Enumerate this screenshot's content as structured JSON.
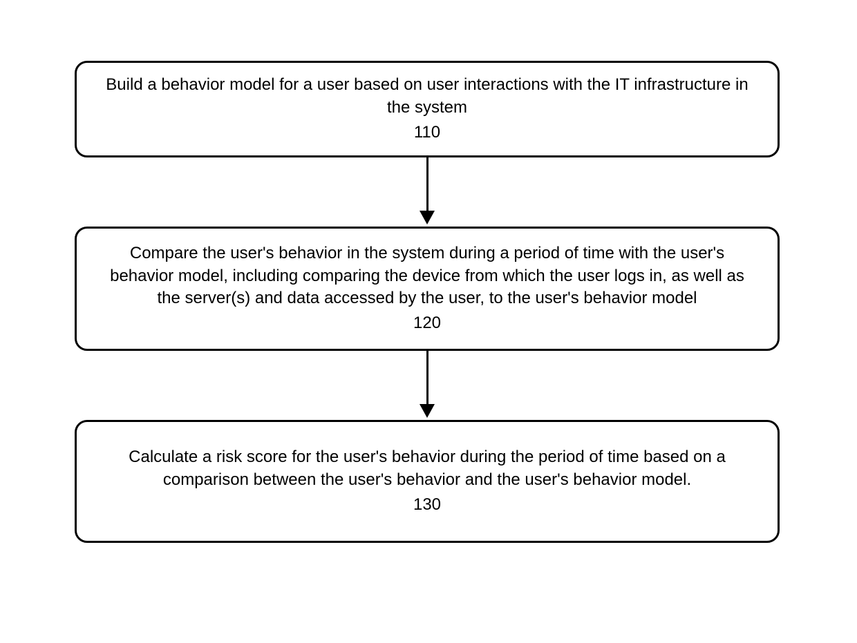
{
  "flowchart": {
    "steps": [
      {
        "text": "Build a behavior model for a user based on user interactions with the IT infrastructure in the system",
        "number": "110"
      },
      {
        "text": "Compare the user's behavior in the system during a period of time with the user's behavior model, including comparing the device from which the user logs in, as well as the server(s) and data accessed by the user, to the user's behavior model",
        "number": "120"
      },
      {
        "text": "Calculate a risk score for the user's behavior during the period of time based on a comparison between the user's behavior and the user's behavior model.",
        "number": "130"
      }
    ]
  }
}
